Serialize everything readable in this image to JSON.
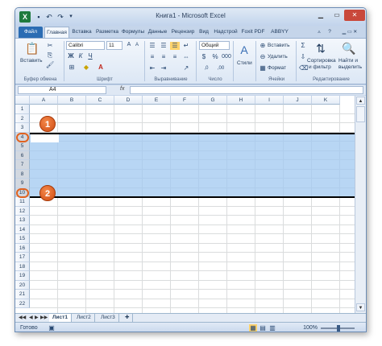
{
  "window": {
    "title": "Книга1 - Microsoft Excel"
  },
  "tabs": [
    {
      "label": "Файл"
    },
    {
      "label": "Главная"
    },
    {
      "label": "Вставка"
    },
    {
      "label": "Разметка"
    },
    {
      "label": "Формулы"
    },
    {
      "label": "Данные"
    },
    {
      "label": "Рецензир"
    },
    {
      "label": "Вид"
    },
    {
      "label": "Надстрой"
    },
    {
      "label": "Foxit PDF"
    },
    {
      "label": "ABBYY PC"
    }
  ],
  "ribbon": {
    "clipboard": {
      "paste": "Вставить",
      "label": "Буфер обмена"
    },
    "font": {
      "name": "Calibri",
      "size": "11",
      "label": "Шрифт"
    },
    "align": {
      "label": "Выравнивание"
    },
    "number": {
      "format": "Общий",
      "label": "Число"
    },
    "styles": {
      "button": "Стили"
    },
    "cells": {
      "insert": "Вставить",
      "delete": "Удалить",
      "format": "Формат",
      "label": "Ячейки"
    },
    "editing": {
      "sort": "Сортировка",
      "sort2": "и фильтр",
      "find": "Найти и",
      "find2": "выделить",
      "label": "Редактирование"
    }
  },
  "formula_bar": {
    "name_box": "A4",
    "fx": "fx",
    "formula": ""
  },
  "columns": [
    "A",
    "B",
    "C",
    "D",
    "E",
    "F",
    "G",
    "H",
    "I",
    "J",
    "K"
  ],
  "rows": [
    "1",
    "2",
    "3",
    "4",
    "5",
    "6",
    "7",
    "8",
    "9",
    "10",
    "11",
    "12",
    "13",
    "14",
    "15",
    "16",
    "17",
    "18",
    "19",
    "20",
    "21",
    "22"
  ],
  "selection": {
    "start_row": "4",
    "end_row": "10"
  },
  "markers": [
    {
      "label": "1"
    },
    {
      "label": "2"
    }
  ],
  "sheets": [
    {
      "label": "Лист1"
    },
    {
      "label": "Лист2"
    },
    {
      "label": "Лист3"
    }
  ],
  "status": {
    "text": "Готово",
    "zoom": "100%"
  }
}
